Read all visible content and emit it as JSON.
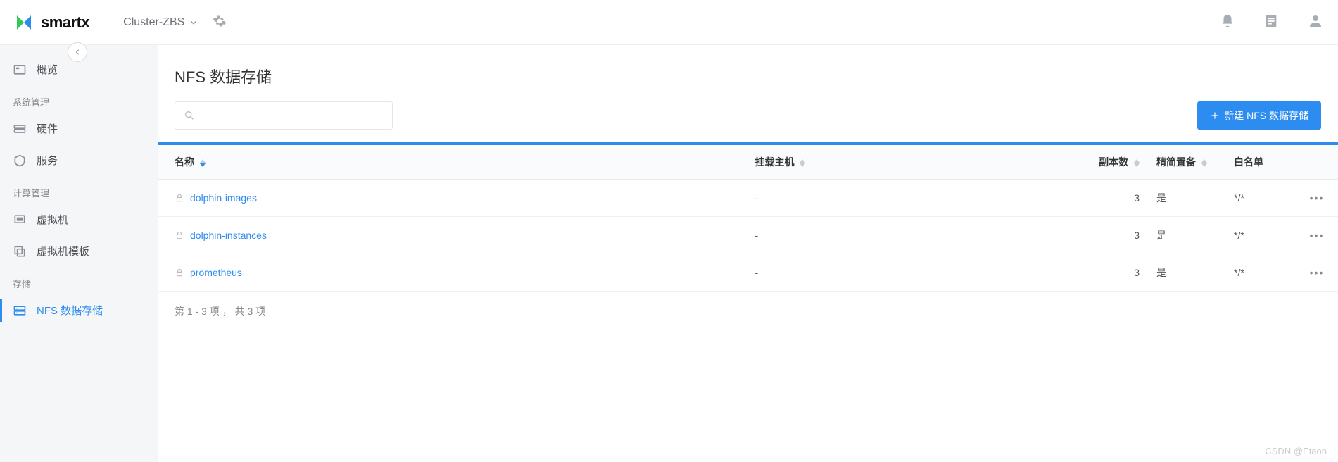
{
  "brand": "smartx",
  "header": {
    "cluster_name": "Cluster-ZBS"
  },
  "sidebar": {
    "overview_label": "概览",
    "group_system": "系统管理",
    "item_hardware": "硬件",
    "item_service": "服务",
    "group_compute": "计算管理",
    "item_vm": "虚拟机",
    "item_template": "虚拟机模板",
    "group_storage": "存储",
    "item_nfs": "NFS 数据存储"
  },
  "page": {
    "title": "NFS 数据存储",
    "search_placeholder": "",
    "create_button": "新建 NFS 数据存储"
  },
  "table": {
    "columns": {
      "name": "名称",
      "mount": "挂载主机",
      "replica": "副本数",
      "thin": "精简置备",
      "whitelist": "白名单"
    },
    "rows": [
      {
        "name": "dolphin-images",
        "mount": "-",
        "replica": "3",
        "thin": "是",
        "whitelist": "*/*"
      },
      {
        "name": "dolphin-instances",
        "mount": "-",
        "replica": "3",
        "thin": "是",
        "whitelist": "*/*"
      },
      {
        "name": "prometheus",
        "mount": "-",
        "replica": "3",
        "thin": "是",
        "whitelist": "*/*"
      }
    ],
    "pagination": "第 1 - 3 项 ， 共 3 项"
  },
  "watermark": "CSDN @Etaon"
}
